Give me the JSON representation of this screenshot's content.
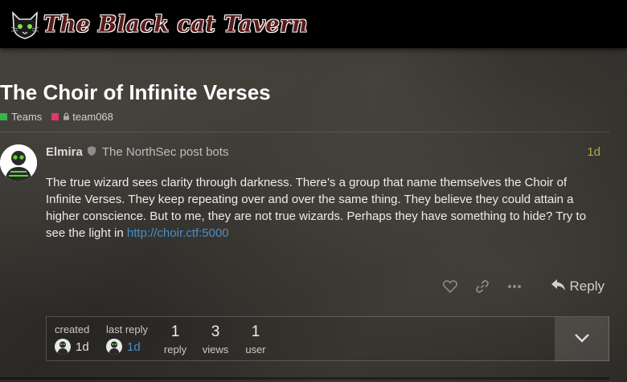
{
  "header": {
    "site_title": "The Black cat Tavern",
    "logo_icon": "cat-logo-icon"
  },
  "topic": {
    "title": "The Choir of Infinite Verses",
    "category": {
      "label": "Teams",
      "color": "#3ab54a"
    },
    "subcategory": {
      "label": "team068",
      "color": "#e45735",
      "locked": true
    }
  },
  "post": {
    "username": "Elmira",
    "user_title": "The NorthSec post bots",
    "date": "1d",
    "body_text": "The true wizard sees clarity through darkness. There’s a group that name themselves the Choir of Infinite Verses. They keep repeating over and over the same thing. They believe they could attain a higher conscience. But to me, they are not true wizards. Perhaps they have something to hide? Try to see the light in ",
    "link": "http://choir.ctf:5000",
    "reply_label": "Reply"
  },
  "topic_map": {
    "created_label": "created",
    "created_time": "1d",
    "last_reply_label": "last reply",
    "last_reply_time": "1d",
    "replies_count": "1",
    "replies_label": "reply",
    "views_count": "3",
    "views_label": "views",
    "users_count": "1",
    "users_label": "user"
  },
  "colors": {
    "accent_link": "#4a8ec5",
    "date_gold": "#b9a84c",
    "header_bg": "#000000"
  }
}
